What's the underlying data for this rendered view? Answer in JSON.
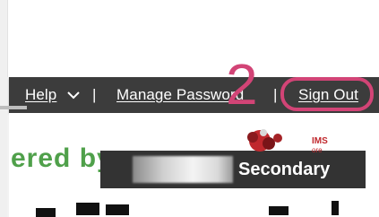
{
  "nav": {
    "help_label": "Help",
    "separator": "|",
    "manage_password_label": "Manage Password",
    "sign_out_label": "Sign Out"
  },
  "annotation": {
    "step_number": "2",
    "color": "#d24476"
  },
  "branding": {
    "powered_by_text": "ered by",
    "secondary_label": "Secondary",
    "logo_text": "IMS",
    "logo_subtext": "ore"
  },
  "colors": {
    "navbar": "#3c3c3c",
    "powered_green": "#4fa04a",
    "logo_red": "#c0282d"
  }
}
